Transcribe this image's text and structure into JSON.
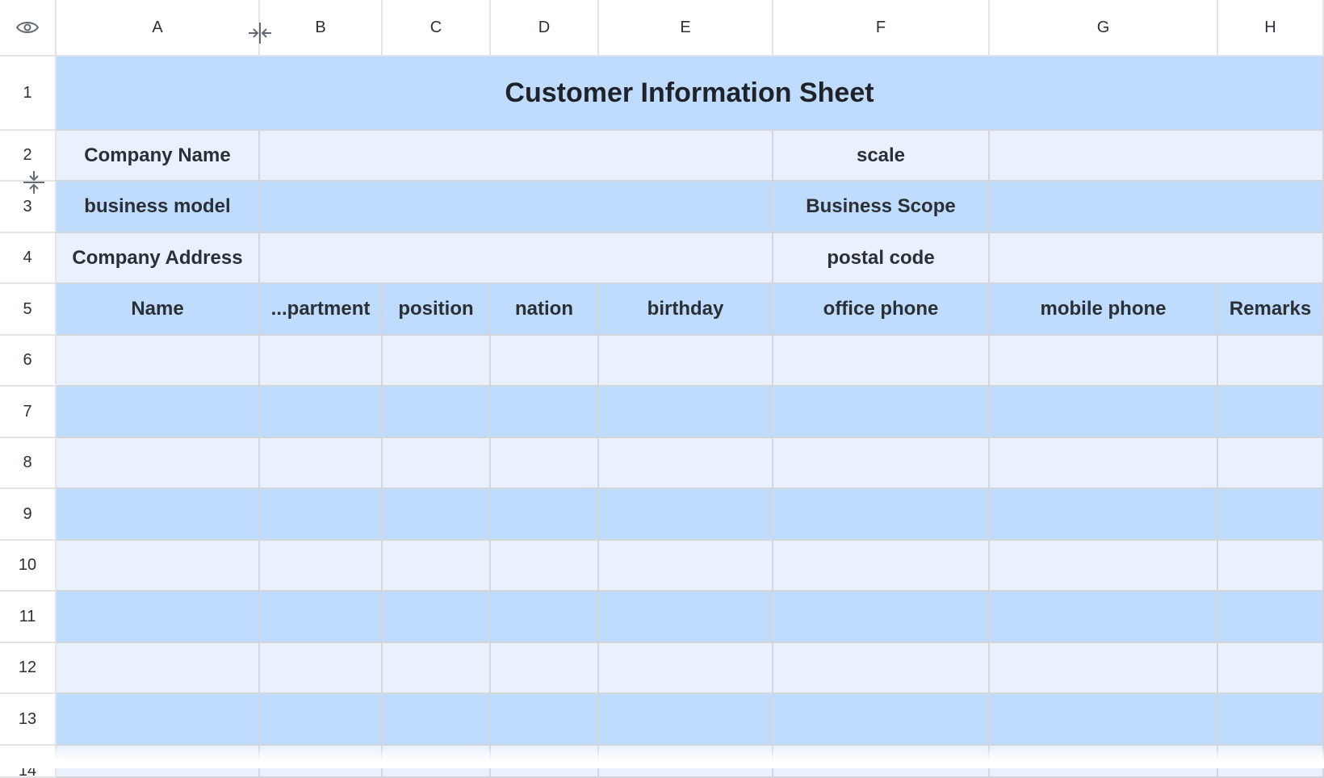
{
  "column_headers": [
    "A",
    "B",
    "C",
    "D",
    "E",
    "F",
    "G",
    "H"
  ],
  "row_headers": [
    "1",
    "2",
    "3",
    "4",
    "5",
    "6",
    "7",
    "8",
    "9",
    "10",
    "11",
    "12",
    "13",
    "14"
  ],
  "corner_icon": "eye-icon",
  "sheet": {
    "title": "Customer Information Sheet",
    "info_rows": [
      {
        "left_label": "Company Name",
        "right_label": "scale"
      },
      {
        "left_label": "business model",
        "right_label": "Business Scope"
      },
      {
        "left_label": "Company Address",
        "right_label": "postal code"
      }
    ],
    "table_headers": [
      "Name",
      "...partment",
      "position",
      "nation",
      "birthday",
      "office phone",
      "mobile phone",
      "Remarks"
    ]
  },
  "colors": {
    "band_dark": "#bfdbfe",
    "band_light": "#e8f1fd",
    "grid_line": "#d3d6db"
  },
  "icons": {
    "column_resize": "column-resize-icon",
    "row_resize": "row-resize-icon"
  }
}
